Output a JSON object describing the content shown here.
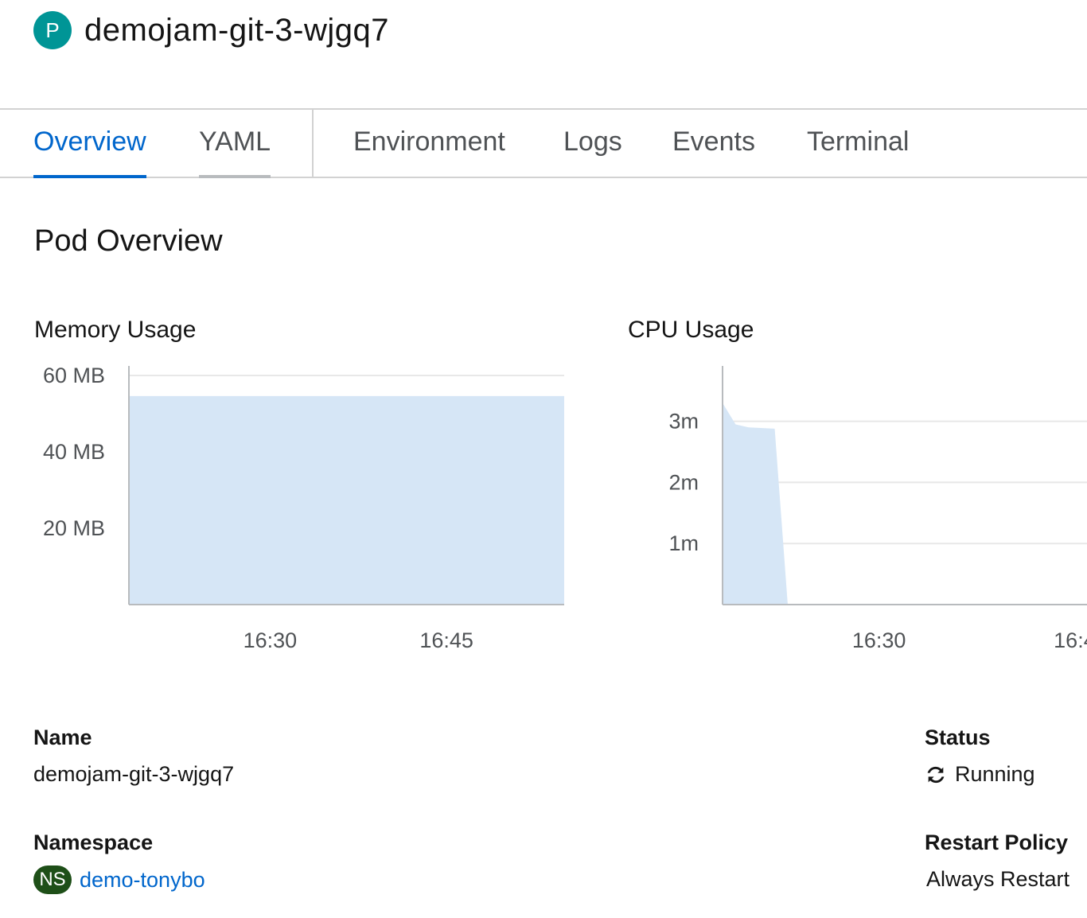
{
  "header": {
    "badge_letter": "P",
    "badge_color": "#009596",
    "title": "demojam-git-3-wjgq7"
  },
  "tabs": [
    {
      "label": "Overview",
      "active": true
    },
    {
      "label": "YAML",
      "hover": true
    },
    {
      "label": "Environment"
    },
    {
      "label": "Logs"
    },
    {
      "label": "Events"
    },
    {
      "label": "Terminal"
    }
  ],
  "colors": {
    "accent": "#0066cc",
    "tab_hover": "#b8bbbe",
    "area_fill": "#d6e6f6",
    "gridline": "#e8e8e8",
    "axis": "#b8bbbe"
  },
  "overview": {
    "title": "Pod Overview"
  },
  "chart_data": [
    {
      "type": "area",
      "title": "Memory Usage",
      "x": [
        "16:18",
        "16:55"
      ],
      "x_ticks": [
        "16:30",
        "16:45"
      ],
      "y_ticks": [
        "20 MB",
        "40 MB",
        "60 MB"
      ],
      "ylim": [
        0,
        60
      ],
      "series": [
        {
          "values": [
            54.6,
            54.6
          ]
        }
      ],
      "grid": true
    },
    {
      "type": "area",
      "title": "CPU Usage",
      "x": [
        "16:18",
        "16:19",
        "16:20",
        "16:22",
        "16:23"
      ],
      "x_ticks": [
        "16:30",
        "16:4"
      ],
      "y_ticks": [
        "1m",
        "2m",
        "3m"
      ],
      "ylim": [
        0,
        3.75
      ],
      "series": [
        {
          "values": [
            3.3,
            2.95,
            2.9,
            2.88,
            0
          ]
        }
      ],
      "grid": true
    }
  ],
  "details": {
    "name_label": "Name",
    "name_value": "demojam-git-3-wjgq7",
    "namespace_label": "Namespace",
    "namespace_badge": "NS",
    "namespace_value": "demo-tonybo",
    "status_label": "Status",
    "status_icon": "sync-icon",
    "status_value": "Running",
    "restart_label": "Restart Policy",
    "restart_value": "Always Restart"
  }
}
